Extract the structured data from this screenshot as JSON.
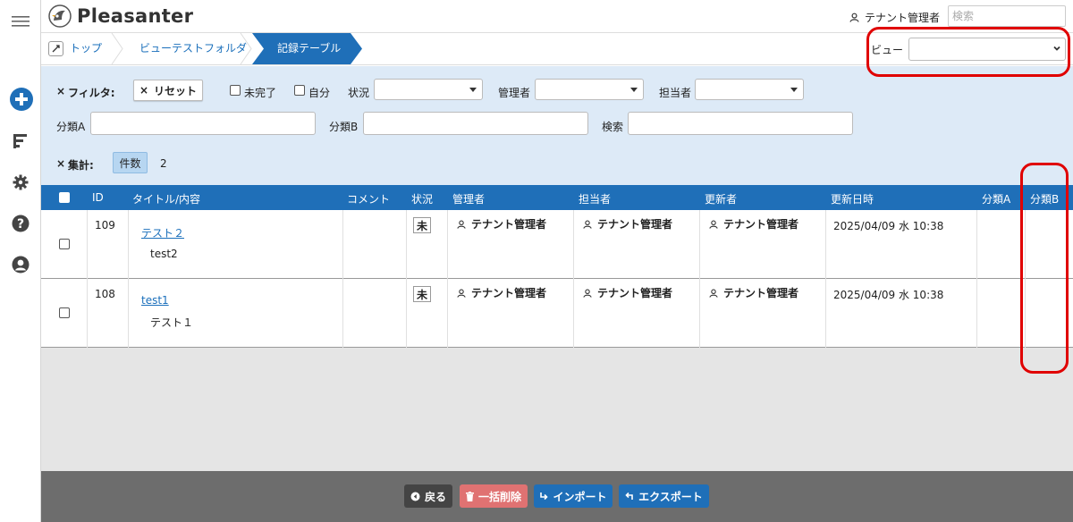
{
  "header": {
    "app_name": "Pleasanter",
    "user_name": "テナント管理者",
    "search_placeholder": "検索"
  },
  "breadcrumb": {
    "items": [
      {
        "label": "トップ"
      },
      {
        "label": "ビューテストフォルダ"
      },
      {
        "label": "記録テーブル"
      }
    ]
  },
  "view": {
    "label": "ビュー",
    "selected": ""
  },
  "filter": {
    "label": "フィルタ:",
    "reset_label": "リセット",
    "incomplete_label": "未完了",
    "self_label": "自分",
    "status_label": "状況",
    "manager_label": "管理者",
    "owner_label": "担当者",
    "class_a_label": "分類A",
    "class_b_label": "分類B",
    "search_label": "検索"
  },
  "aggregation": {
    "label": "集計:",
    "count_label": "件数",
    "count_value": "2"
  },
  "table": {
    "columns": {
      "id": "ID",
      "title": "タイトル/内容",
      "comment": "コメント",
      "status": "状況",
      "manager": "管理者",
      "owner": "担当者",
      "updater": "更新者",
      "updated": "更新日時",
      "class_a": "分類A",
      "class_b": "分類B"
    },
    "rows": [
      {
        "id": "109",
        "title": "テスト２",
        "body": "test2",
        "status": "未",
        "manager": "テナント管理者",
        "owner": "テナント管理者",
        "updater": "テナント管理者",
        "updated": "2025/04/09 水 10:38"
      },
      {
        "id": "108",
        "title": "test1",
        "body": "テスト１",
        "status": "未",
        "manager": "テナント管理者",
        "owner": "テナント管理者",
        "updater": "テナント管理者",
        "updated": "2025/04/09 水 10:38"
      }
    ]
  },
  "footer": {
    "back_label": "戻る",
    "bulk_delete_label": "一括削除",
    "import_label": "インポート",
    "export_label": "エクスポート"
  },
  "colors": {
    "primary": "#1f6fb8",
    "filter_bg": "#ddeaf7",
    "footer_bg": "#6d6d6d",
    "delete": "#e07272",
    "annotation": "#e00000"
  }
}
